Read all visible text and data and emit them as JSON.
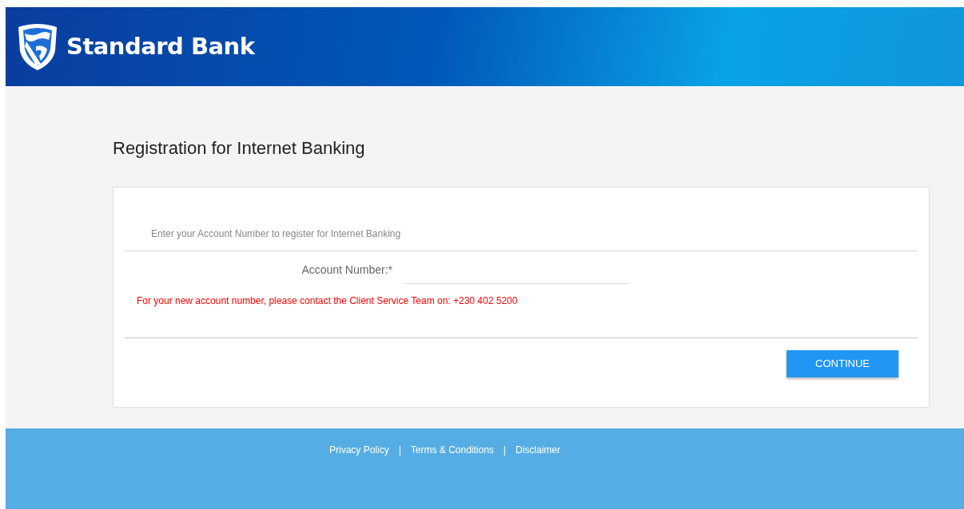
{
  "header": {
    "brand": "Standard Bank"
  },
  "page_title": "Registration for Internet Banking",
  "form": {
    "instruction": "Enter your Account Number to register for Internet Banking",
    "field": {
      "label": "Account Number:*"
    },
    "notice": "For your new account number, please contact the Client Service Team on: +230 402 5200",
    "button": "CONTINUE"
  },
  "footer": {
    "links": [
      "Privacy Policy",
      "Terms & Conditions",
      "Disclaimer"
    ],
    "separator": "|"
  }
}
